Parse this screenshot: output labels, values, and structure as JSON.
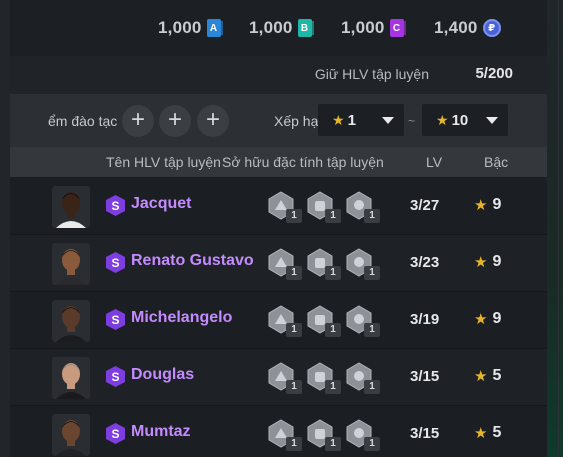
{
  "currency": [
    {
      "amount": "1,000",
      "icon": "A",
      "color": "#2a87d8"
    },
    {
      "amount": "1,000",
      "icon": "B",
      "color": "#1fb7a8"
    },
    {
      "amount": "1,000",
      "icon": "C",
      "color": "#a634e0"
    },
    {
      "amount": "1,400",
      "icon": "coin-icon",
      "color": "#4a64d6"
    }
  ],
  "holdings": {
    "label": "Giữ HLV tập luyện",
    "value": "5/200"
  },
  "filter": {
    "training_label": "ểm đào tạc",
    "sort_label": "Xếp hạ",
    "range_min": "1",
    "range_sep": "~",
    "range_max": "10"
  },
  "table": {
    "headers": {
      "name": "Tên HLV tập luyện",
      "traits": "Sở hữu đặc tính tập luyện",
      "lv": "LV",
      "rank": "Bậc"
    },
    "rows": [
      {
        "name": "Jacquet",
        "lv": "3/27",
        "rank": "9",
        "trait_levels": [
          "1",
          "1",
          "1"
        ]
      },
      {
        "name": "Renato Gustavo",
        "lv": "3/23",
        "rank": "9",
        "trait_levels": [
          "1",
          "1",
          "1"
        ]
      },
      {
        "name": "Michelangelo",
        "lv": "3/19",
        "rank": "9",
        "trait_levels": [
          "1",
          "1",
          "1"
        ]
      },
      {
        "name": "Douglas",
        "lv": "3/15",
        "rank": "5",
        "trait_levels": [
          "1",
          "1",
          "1"
        ]
      },
      {
        "name": "Mumtaz",
        "lv": "3/15",
        "rank": "5",
        "trait_levels": [
          "1",
          "1",
          "1"
        ]
      }
    ]
  },
  "colors": {
    "accent_name": "#c48bff",
    "star": "#e6b52b"
  }
}
